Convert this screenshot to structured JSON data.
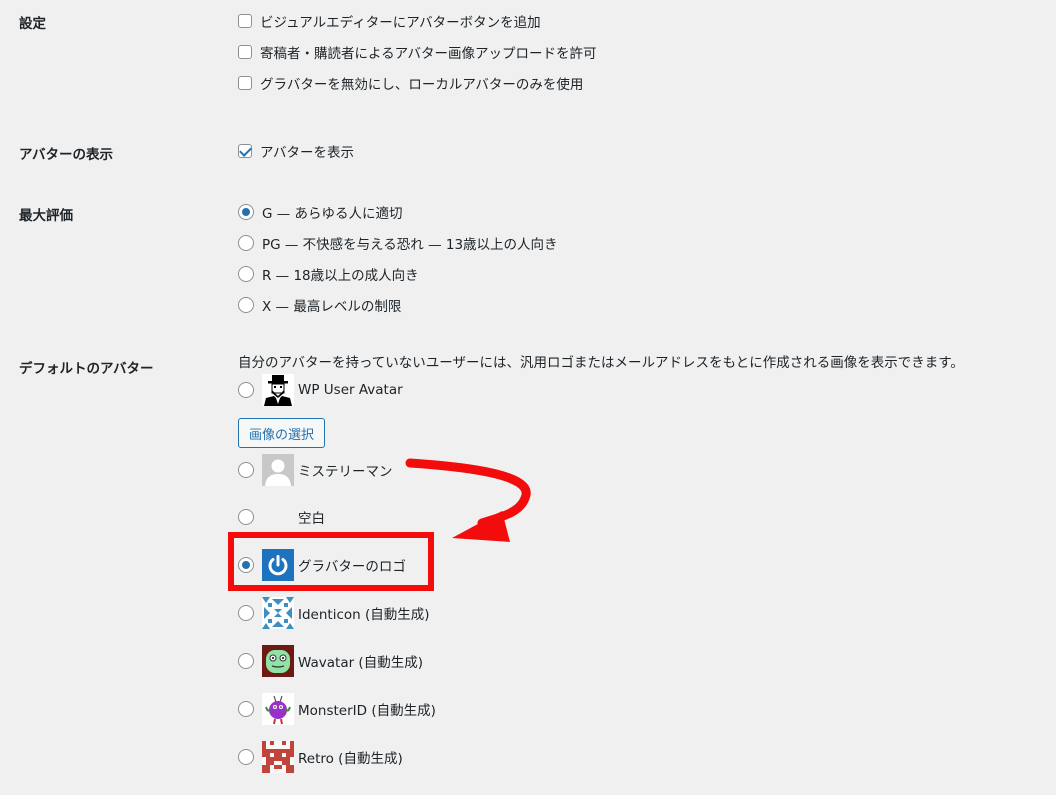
{
  "settings": {
    "label": "設定",
    "options": [
      {
        "label": "ビジュアルエディターにアバターボタンを追加",
        "checked": false
      },
      {
        "label": "寄稿者・購読者によるアバター画像アップロードを許可",
        "checked": false
      },
      {
        "label": "グラバターを無効にし、ローカルアバターのみを使用",
        "checked": false
      }
    ]
  },
  "avatar_display": {
    "label": "アバターの表示",
    "option": {
      "label": "アバターを表示",
      "checked": true
    }
  },
  "max_rating": {
    "label": "最大評価",
    "options": [
      {
        "label": "G — あらゆる人に適切",
        "checked": true
      },
      {
        "label": "PG — 不快感を与える恐れ — 13歳以上の人向き",
        "checked": false
      },
      {
        "label": "R — 18歳以上の成人向き",
        "checked": false
      },
      {
        "label": "X — 最高レベルの制限",
        "checked": false
      }
    ]
  },
  "default_avatar": {
    "label": "デフォルトのアバター",
    "description": "自分のアバターを持っていないユーザーには、汎用ロゴまたはメールアドレスをもとに作成される画像を表示できます。",
    "select_image_button": "画像の選択",
    "options": [
      {
        "label": "WP User Avatar",
        "icon": "wp-user-avatar-icon",
        "checked": false
      },
      {
        "label": "ミステリーマン",
        "icon": "mystery-man-icon",
        "checked": false
      },
      {
        "label": "空白",
        "icon": "blank-icon",
        "checked": false
      },
      {
        "label": "グラバターのロゴ",
        "icon": "gravatar-logo-icon",
        "checked": true
      },
      {
        "label": "Identicon (自動生成)",
        "icon": "identicon-icon",
        "checked": false
      },
      {
        "label": "Wavatar (自動生成)",
        "icon": "wavatar-icon",
        "checked": false
      },
      {
        "label": "MonsterID (自動生成)",
        "icon": "monsterid-icon",
        "checked": false
      },
      {
        "label": "Retro (自動生成)",
        "icon": "retro-icon",
        "checked": false
      }
    ]
  },
  "colors": {
    "accent": "#2271b1",
    "highlight": "#f20c0c",
    "background": "#f0f0f1"
  }
}
